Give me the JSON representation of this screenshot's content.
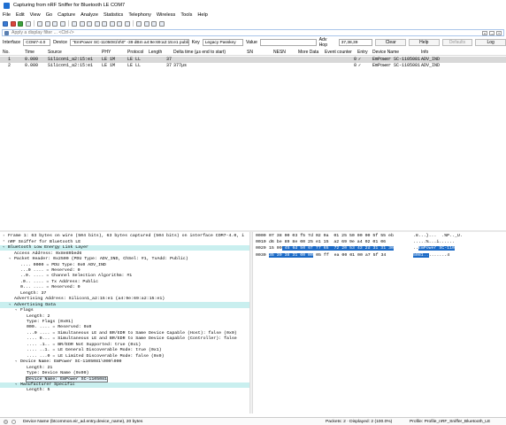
{
  "window": {
    "title": "Capturing from nRF Sniffer for Bluetooth LE COM7"
  },
  "menu": [
    "File",
    "Edit",
    "View",
    "Go",
    "Capture",
    "Analyze",
    "Statistics",
    "Telephony",
    "Wireless",
    "Tools",
    "Help"
  ],
  "filter": {
    "placeholder": "Apply a display filter ... <Ctrl-/>"
  },
  "sniffer": {
    "interface_label": "Interface",
    "interface_value": "COM7-4.0",
    "device_label": "Device",
    "device_value": "\"EmPower SC-1105081\\0\\0\"  -39 dBm  a4:9e:69:a2:15:e1  public",
    "key_label": "Key",
    "key_value": "Legacy Passkey",
    "value_label": "Value",
    "adv_hop_label": "Adv Hop",
    "adv_hop_value": "37,38,39",
    "clear_label": "Clear",
    "help_label": "Help",
    "defaults_label": "Defaults",
    "log_label": "Log"
  },
  "columns": [
    "No.",
    "Time",
    "Source",
    "PHY",
    "Protocol",
    "Length",
    "Delta time (µs end to start)",
    "SN",
    "NESN",
    "More Data",
    "Event counter",
    "Entry",
    "Device Name",
    "Info"
  ],
  "packets": [
    {
      "no": "1",
      "time": "0.000",
      "source": "Silicon1_a2:15:e1",
      "phy": "LE 1M",
      "protocol": "LE LL",
      "length": "37",
      "delta": "",
      "entry_num": "0",
      "entry_check": "✓",
      "device_name": "EmPower SC-1105081",
      "info": "ADV_IND"
    },
    {
      "no": "2",
      "time": "0.000",
      "source": "Silicon1_a2:15:e1",
      "phy": "LE 1M",
      "protocol": "LE LL",
      "length": "37",
      "delta": "377µs",
      "entry_num": "0",
      "entry_check": "✓",
      "device_name": "EmPower SC-1105081",
      "info": "ADV_IND"
    }
  ],
  "details": [
    {
      "text": "Frame 1: 63 bytes on wire (504 bits), 63 bytes captured (504 bits) on interface COM7-4.0, i",
      "indent": 0,
      "twisty": ">",
      "hl": false
    },
    {
      "text": "nRF Sniffer for Bluetooth LE",
      "indent": 0,
      "twisty": ">",
      "hl": false
    },
    {
      "text": "Bluetooth Low Energy Link Layer",
      "indent": 0,
      "twisty": "v",
      "hl": true
    },
    {
      "text": "Access Address: 0x8e89bed6",
      "indent": 1,
      "twisty": "",
      "hl": false
    },
    {
      "text": "Packet Header: 0x2500 (PDU Type: ADV_IND, ChSel: #1, TxAdd: Public)",
      "indent": 1,
      "twisty": "v",
      "hl": false
    },
    {
      "text": ".... 0000 = PDU Type: 0x0 ADV_IND",
      "indent": 2,
      "twisty": "",
      "hl": false
    },
    {
      "text": "...0 .... = Reserved: 0",
      "indent": 2,
      "twisty": "",
      "hl": false
    },
    {
      "text": "..0. .... = Channel Selection Algorithm: #1",
      "indent": 2,
      "twisty": "",
      "hl": false
    },
    {
      "text": ".0.. .... = Tx Address: Public",
      "indent": 2,
      "twisty": "",
      "hl": false
    },
    {
      "text": "0... .... = Reserved: 0",
      "indent": 2,
      "twisty": "",
      "hl": false
    },
    {
      "text": "Length: 37",
      "indent": 2,
      "twisty": "",
      "hl": false
    },
    {
      "text": "Advertising Address: Silicon1_a2:15:e1 (a4:9e:69:a2:15:e1)",
      "indent": 1,
      "twisty": "",
      "hl": false
    },
    {
      "text": "Advertising Data",
      "indent": 1,
      "twisty": "v",
      "hl": true
    },
    {
      "text": "Flags",
      "indent": 2,
      "twisty": "v",
      "hl": false
    },
    {
      "text": "Length: 2",
      "indent": 3,
      "twisty": "",
      "hl": false
    },
    {
      "text": "Type: Flags (0x01)",
      "indent": 3,
      "twisty": "",
      "hl": false
    },
    {
      "text": "000. .... = Reserved: 0x0",
      "indent": 3,
      "twisty": "",
      "hl": false
    },
    {
      "text": "...0 .... = Simultaneous LE and BR/EDR to Same Device Capable (Host): false (0x0)",
      "indent": 3,
      "twisty": "",
      "hl": false
    },
    {
      "text": ".... 0... = Simultaneous LE and BR/EDR to Same Device Capable (Controller): false",
      "indent": 3,
      "twisty": "",
      "hl": false
    },
    {
      "text": ".... .1.. = BR/EDR Not Supported: true (0x1)",
      "indent": 3,
      "twisty": "",
      "hl": false
    },
    {
      "text": ".... ..1. = LE General Discoverable Mode: true (0x1)",
      "indent": 3,
      "twisty": "",
      "hl": false
    },
    {
      "text": ".... ...0 = LE Limited Discoverable Mode: false (0x0)",
      "indent": 3,
      "twisty": "",
      "hl": false
    },
    {
      "text": "Device Name: EmPower SC-1105081\\000\\000",
      "indent": 2,
      "twisty": "v",
      "hl": false
    },
    {
      "text": "Length: 21",
      "indent": 3,
      "twisty": "",
      "hl": false
    },
    {
      "text": "Type: Device Name (0x09)",
      "indent": 3,
      "twisty": "",
      "hl": false
    },
    {
      "text": "Device Name: EmPower SC-1105081",
      "indent": 3,
      "twisty": "",
      "hl": false,
      "boxed": true
    },
    {
      "text": "Manufacturer Specific",
      "indent": 2,
      "twisty": "v",
      "hl": true
    },
    {
      "text": "Length: 5",
      "indent": 3,
      "twisty": "",
      "hl": false
    }
  ],
  "bytes": [
    {
      "off": "0000",
      "pre": "07 38 00 03 f5 7d 02 0a  01 25 50 00 00 5f 55 eb",
      "sel": "",
      "post": "",
      "apre": ".8...}...  .%P.._U.",
      "asel": "",
      "apost": ""
    },
    {
      "off": "0010",
      "pre": "d6 be 89 8e 00 25 e1 15  a2 69 9e a4 02 01 06 ",
      "sel": "",
      "post": "",
      "apre": ".....%...i......",
      "asel": "",
      "apost": ""
    },
    {
      "off": "0020",
      "pre": "15 09",
      "sel": " 45 6d 50 6f 77 65  72 20 53 43 2d 31 31 30",
      "post": "",
      "apre": "..",
      "asel": "EmPower SC-110",
      "apost": ""
    },
    {
      "off": "0030",
      "pre": "",
      "sel": "35 30 38 31 00 00",
      "post": " 05 ff  ea 00 01 00 a7 5f 34",
      "apre": "",
      "asel": "5081..",
      "apost": ".......4"
    }
  ],
  "status": {
    "field": "Device Name (btcommon.eir_ad.entry.device_name), 20 bytes",
    "counts": "Packets: 2 · Displayed: 2 (100.0%)",
    "profile": "Profile: Profile_nRF_Sniffer_Bluetooth_LE"
  }
}
